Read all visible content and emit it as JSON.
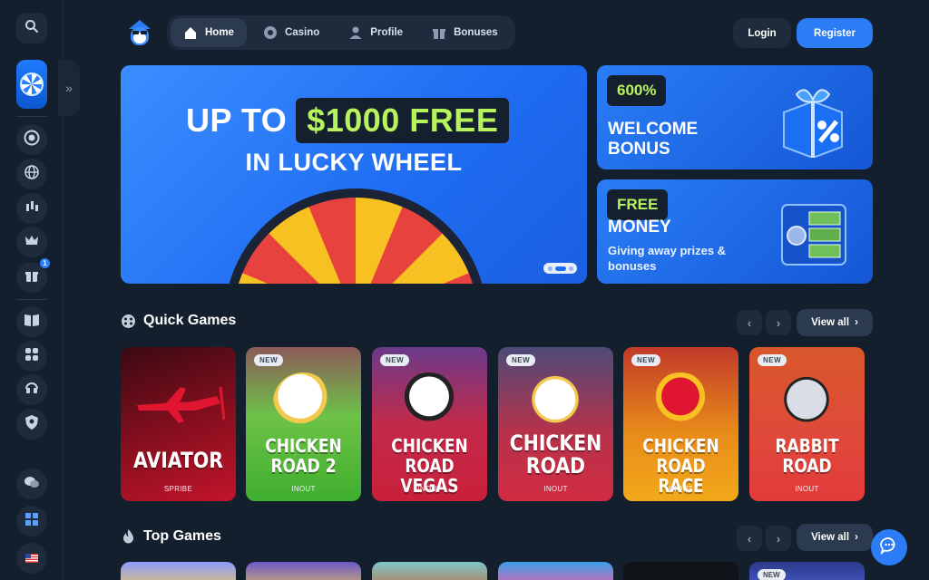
{
  "nav": {
    "items": [
      {
        "label": "Home",
        "icon": "home-icon",
        "active": true
      },
      {
        "label": "Casino",
        "icon": "chip-icon",
        "active": false
      },
      {
        "label": "Profile",
        "icon": "user-icon",
        "active": false
      },
      {
        "label": "Bonuses",
        "icon": "gift-icon",
        "active": false
      }
    ]
  },
  "auth": {
    "login": "Login",
    "register": "Register"
  },
  "hero": {
    "line1_prefix": "UP TO",
    "line1_highlight": "$1000 FREE",
    "line2": "IN LUCKY WHEEL",
    "prev": "‹",
    "next": "›"
  },
  "promos": [
    {
      "tag": "600%",
      "title": "WELCOME BONUS"
    },
    {
      "tag": "FREE",
      "title": "MONEY",
      "subtitle": "Giving away prizes & bonuses"
    }
  ],
  "quick_games": {
    "title": "Quick Games",
    "view_all": "View all",
    "games": [
      {
        "name": "AVIATOR",
        "provider": "SPRIBE",
        "is_new": false
      },
      {
        "name": "CHICKEN ROAD 2",
        "provider": "INOUT",
        "is_new": true
      },
      {
        "name": "CHICKEN ROAD VEGAS",
        "provider": "INOUT",
        "is_new": true
      },
      {
        "name": "CHICKEN ROAD",
        "provider": "INOUT",
        "is_new": true
      },
      {
        "name": "CHICKEN ROAD RACE",
        "provider": "INOUT",
        "is_new": true
      },
      {
        "name": "RABBIT ROAD",
        "provider": "INOUT",
        "is_new": true
      }
    ],
    "new_label": "NEW"
  },
  "top_games": {
    "title": "Top Games",
    "view_all": "View all",
    "new_label": "NEW"
  },
  "sidebar": {
    "notification_count": "1"
  },
  "colors": {
    "background": "#141f2e",
    "panel": "#1e2b3c",
    "accent_blue": "#2c7cf6",
    "lime": "#b6f35c"
  }
}
